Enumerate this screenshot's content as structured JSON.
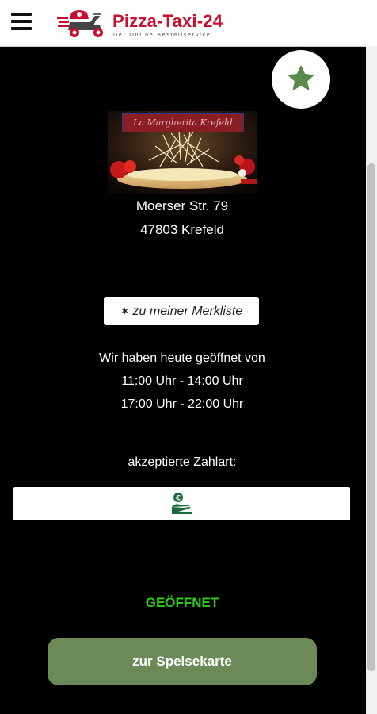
{
  "header": {
    "brand_name": "Pizza-Taxi-24",
    "brand_tagline": "Der Online Bestellservice",
    "menu_icon": "hamburger-menu-icon",
    "logo_icon": "scooter-delivery-icon"
  },
  "favorite_fab": {
    "icon": "star-icon",
    "color": "#5a8a4a"
  },
  "restaurant": {
    "name": "La Margherita Krefeld",
    "street": "Moerser Str. 79",
    "city": "47803 Krefeld"
  },
  "merkliste_button": {
    "icon": "✶",
    "label": "zu meiner Merkliste"
  },
  "hours": {
    "intro": "Wir haben heute geöffnet von",
    "slots": [
      "11:00 Uhr - 14:00 Uhr",
      "17:00 Uhr - 22:00 Uhr"
    ]
  },
  "payment": {
    "label": "akzeptierte Zahlart:",
    "methods": [
      "cash-payment-icon"
    ]
  },
  "status": {
    "text": "GEÖFFNET",
    "color": "#2ecc1a"
  },
  "menu_button": {
    "label": "zur Speisekarte",
    "color": "#6b8a57"
  }
}
